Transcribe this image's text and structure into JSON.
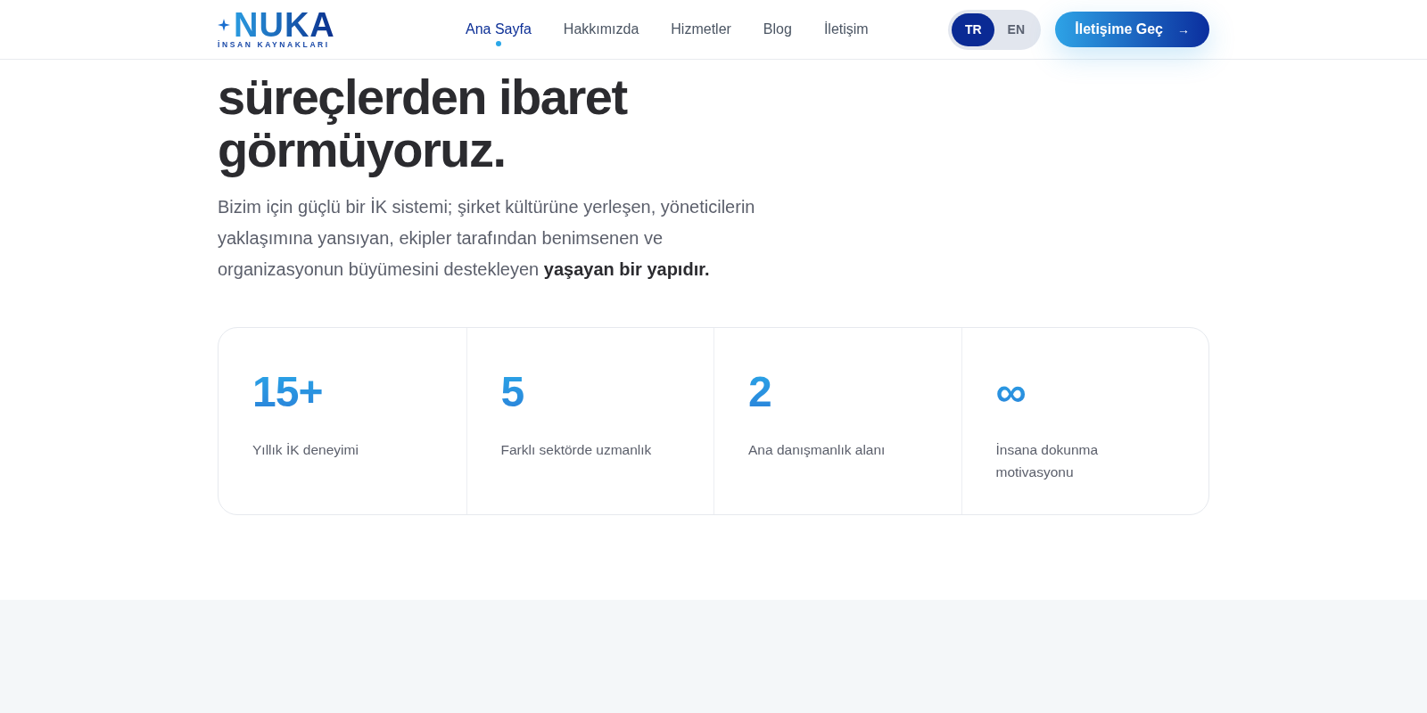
{
  "header": {
    "logo": {
      "title": "NUKA",
      "subtitle": "İNSAN KAYNAKLARI"
    },
    "nav": [
      {
        "label": "Ana Sayfa",
        "selected": true
      },
      {
        "label": "Hakkımızda",
        "selected": false
      },
      {
        "label": "Hizmetler",
        "selected": false
      },
      {
        "label": "Blog",
        "selected": false
      },
      {
        "label": "İletişim",
        "selected": false
      }
    ],
    "languages": [
      {
        "label": "TR",
        "selected": true
      },
      {
        "label": "EN",
        "selected": false
      }
    ],
    "cta": {
      "label": "İletişime Geç",
      "arrow": "→"
    }
  },
  "hero": {
    "heading_lines": [
      "süreçlerden ibaret",
      "görmüyoruz."
    ],
    "description": "Bizim için güçlü bir İK sistemi; şirket kültürüne yerleşen, yöneticilerin yaklaşımına yansıyan, ekipler tarafından benimsenen ve organizasyonun büyümesini destekleyen **yaşayan bir yapıdır.**"
  },
  "stats": [
    {
      "value": "15+",
      "label": "Yıllık İK deneyimi"
    },
    {
      "value": "5",
      "label": "Farklı sektörde uzmanlık"
    },
    {
      "value": "2",
      "label": "Ana danışmanlık alanı"
    },
    {
      "value": "∞",
      "label": "İnsana dokunma motivasyonu"
    }
  ]
}
